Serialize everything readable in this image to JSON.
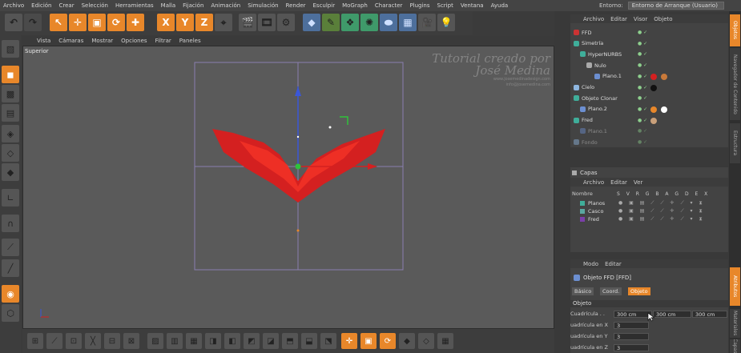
{
  "menubar": {
    "items": [
      "Archivo",
      "Edición",
      "Crear",
      "Selección",
      "Herramientas",
      "Malla",
      "Fijación",
      "Animación",
      "Simulación",
      "Render",
      "Esculpir",
      "MoGraph",
      "Character",
      "Plugins",
      "Script",
      "Ventana",
      "Ayuda"
    ]
  },
  "environment": {
    "label": "Entorno:",
    "value": "Entorno de Arranque (Usuario)"
  },
  "toolbar": {
    "axis_x": "X",
    "axis_y": "Y",
    "axis_z": "Z"
  },
  "viewport": {
    "menu": [
      "Vista",
      "Cámaras",
      "Mostrar",
      "Opciones",
      "Filtrar",
      "Paneles"
    ],
    "label": "Superior",
    "watermark_line1": "Tutorial creado por",
    "watermark_line2": "José Medina",
    "watermark_line3": "www.josemedinadesign.com",
    "watermark_line4": "info@josemedina.com"
  },
  "object_manager": {
    "menu": [
      "Archivo",
      "Editar",
      "Visor",
      "Objeto"
    ],
    "objects": [
      {
        "name": "FFD",
        "color": "#cc3333"
      },
      {
        "name": "Simetría",
        "color": "#3fae9a"
      },
      {
        "name": "HyperNURBS",
        "color": "#3fae9a"
      },
      {
        "name": "Nulo",
        "color": "#aaaaaa"
      },
      {
        "name": "Plano.1",
        "color": "#6c8fd1"
      },
      {
        "name": "Cielo",
        "color": "#8fb7e0"
      },
      {
        "name": "Objeto Clonar",
        "color": "#3fae9a"
      },
      {
        "name": "Plano.2",
        "color": "#6c8fd1"
      },
      {
        "name": "Fred",
        "color": "#3fae9a"
      },
      {
        "name": "Plano.1",
        "color": "#6c8fd1"
      },
      {
        "name": "Fondo",
        "color": "#8fb7e0"
      }
    ]
  },
  "layers": {
    "title": "Capas",
    "menu": [
      "Archivo",
      "Editar",
      "Ver"
    ],
    "header_name": "Nombre",
    "header_flags": "S V R G B A G D E X",
    "rows": [
      {
        "name": "Planos",
        "color": "#3fae9a"
      },
      {
        "name": "Casco",
        "color": "#5aa7a0"
      },
      {
        "name": "Fred",
        "color": "#7a3fa8"
      }
    ]
  },
  "attributes": {
    "menu": [
      "Modo",
      "Editar"
    ],
    "object_title": "Objeto FFD [FFD]",
    "tabs": [
      "Básico",
      "Coord.",
      "Objeto"
    ],
    "active_tab": "Objeto",
    "section": "Objeto",
    "grid_label": "Cuadrícula . .",
    "grid_values": [
      "300 cm",
      "300 cm",
      "300 cm"
    ],
    "rows": [
      {
        "label": "uadrícula en X",
        "value": "3"
      },
      {
        "label": "uadrícula en Y",
        "value": "3"
      },
      {
        "label": "uadrícula en Z",
        "value": "3"
      }
    ]
  },
  "side_tabs": [
    "Objetos",
    "Navegador de Contenido",
    "Estructura",
    "Atributos",
    "Materiales",
    "Capas"
  ],
  "colors": {
    "accent": "#e8872a",
    "model": "#d42020"
  }
}
